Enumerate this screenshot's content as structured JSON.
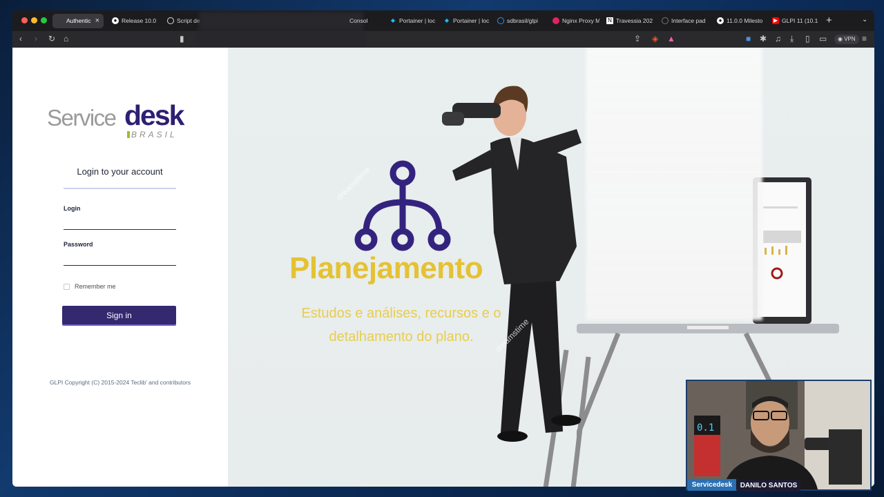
{
  "browser": {
    "tabs": [
      {
        "label": "Authentic",
        "icon": "globe-icon",
        "active": true
      },
      {
        "label": "Release 10.0",
        "icon": "github-icon"
      },
      {
        "label": "Script de",
        "icon": "circle-icon"
      },
      {
        "label": "Consol",
        "icon": ""
      },
      {
        "label": "Portainer | loc",
        "icon": "portainer-icon"
      },
      {
        "label": "Portainer | loc",
        "icon": "portainer-icon"
      },
      {
        "label": "sdbrasil/glpi",
        "icon": "docker-icon"
      },
      {
        "label": "Nginx Proxy M",
        "icon": "nginx-icon"
      },
      {
        "label": "Travessia 202",
        "icon": "notion-icon"
      },
      {
        "label": "Interface pad",
        "icon": "circle-icon"
      },
      {
        "label": "11.0.0 Milesto",
        "icon": "github-icon"
      },
      {
        "label": "GLPI 11 (10.1",
        "icon": "youtube-icon"
      }
    ],
    "vpn_label": "VPN"
  },
  "login": {
    "logo_service": "Service",
    "logo_desk": "desk",
    "logo_brasil": "BRASIL",
    "title": "Login to your account",
    "login_label": "Login",
    "login_value": "",
    "password_label": "Password",
    "password_value": "",
    "remember_label": "Remember me",
    "signin_label": "Sign in",
    "copyright": "GLPI Copyright (C) 2015-2024 Teclib' and contributors"
  },
  "hero": {
    "title": "Planejamento",
    "subtitle_line1": "Estudos e análises, recursos e o",
    "subtitle_line2": "detalhamento do plano."
  },
  "overlay": {
    "brand": "Servicedesk",
    "presenter": "DANILO SANTOS"
  },
  "colors": {
    "brand_purple": "#34296f",
    "hero_yellow": "#e4c232",
    "page_bg": "#e9eeee"
  }
}
